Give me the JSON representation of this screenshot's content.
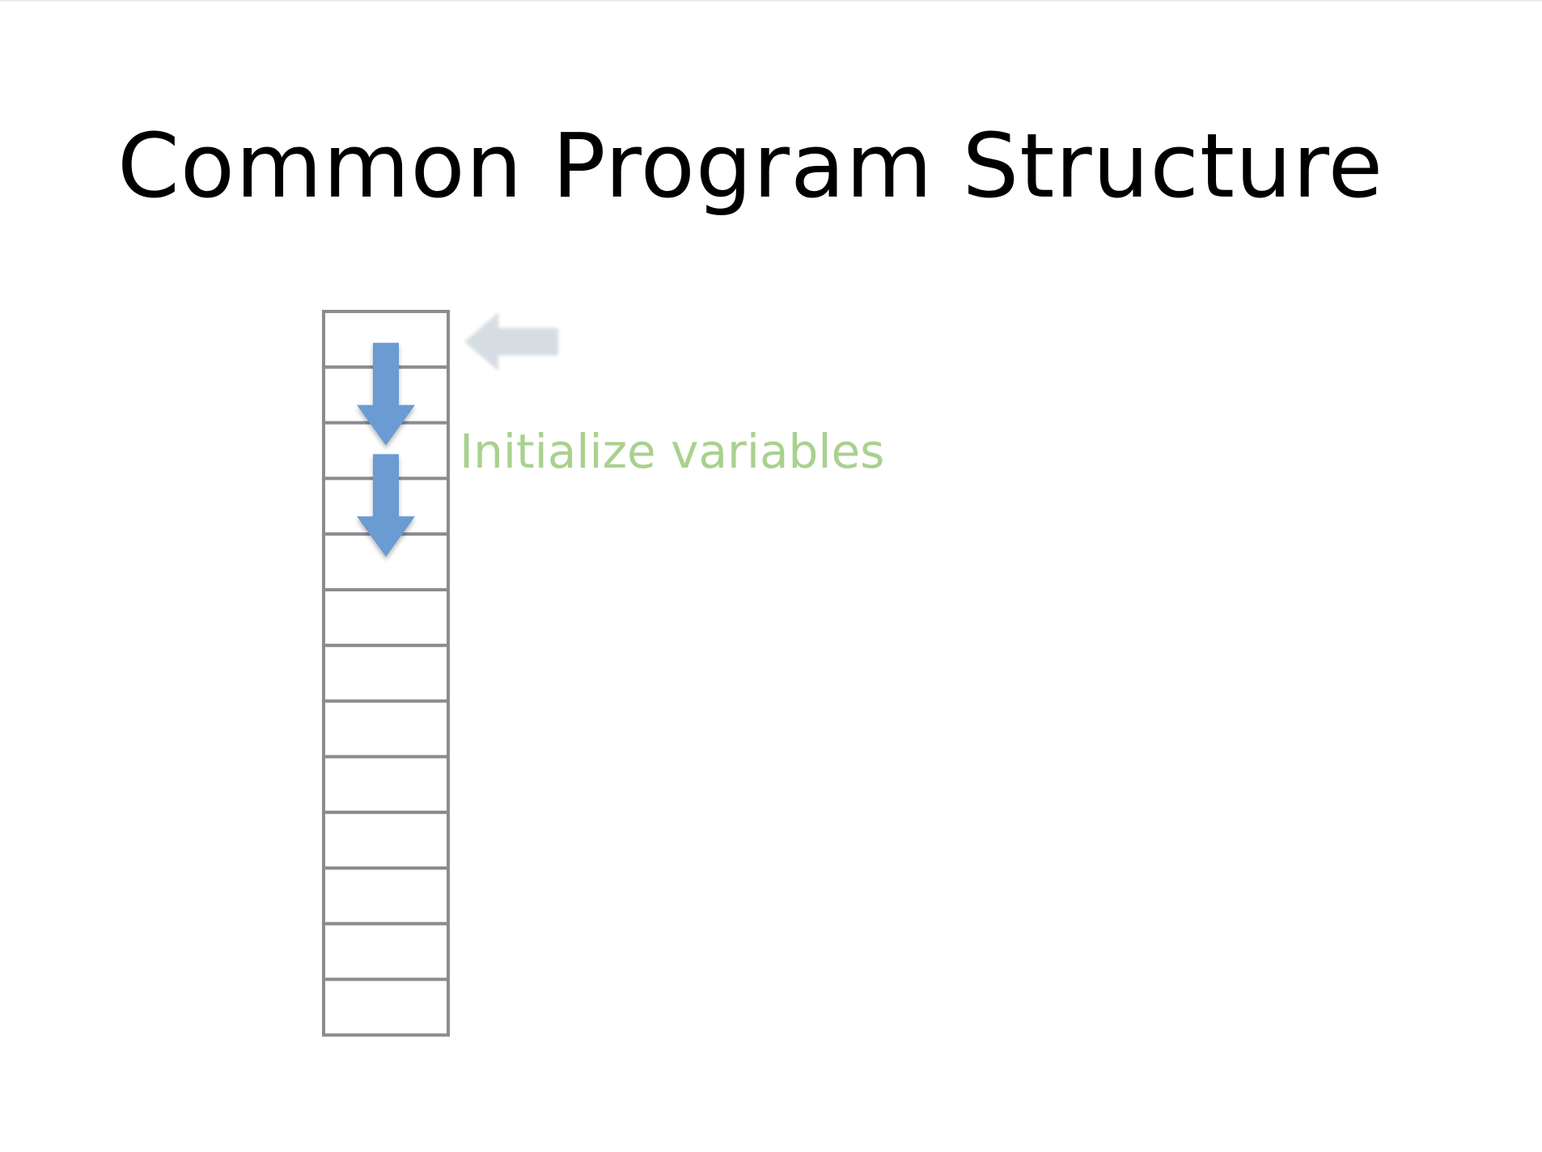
{
  "slide": {
    "title": "Common Program Structure",
    "annotation": "Initialize variables"
  },
  "diagram": {
    "cell_count": 13,
    "current_cell_index": 0,
    "step_arrows": [
      {
        "from_cell": 1,
        "to_cell": 2
      },
      {
        "from_cell": 3,
        "to_cell": 4
      }
    ]
  },
  "icons": {
    "pointer_arrow": "arrow-left-icon",
    "step_arrow": "arrow-down-icon"
  },
  "colors": {
    "title": "#000000",
    "annotation": "#a9d18e",
    "cell_border": "#8c8c90",
    "step_arrow": "#6b9bd2",
    "pointer_arrow": "#d5dde3"
  }
}
